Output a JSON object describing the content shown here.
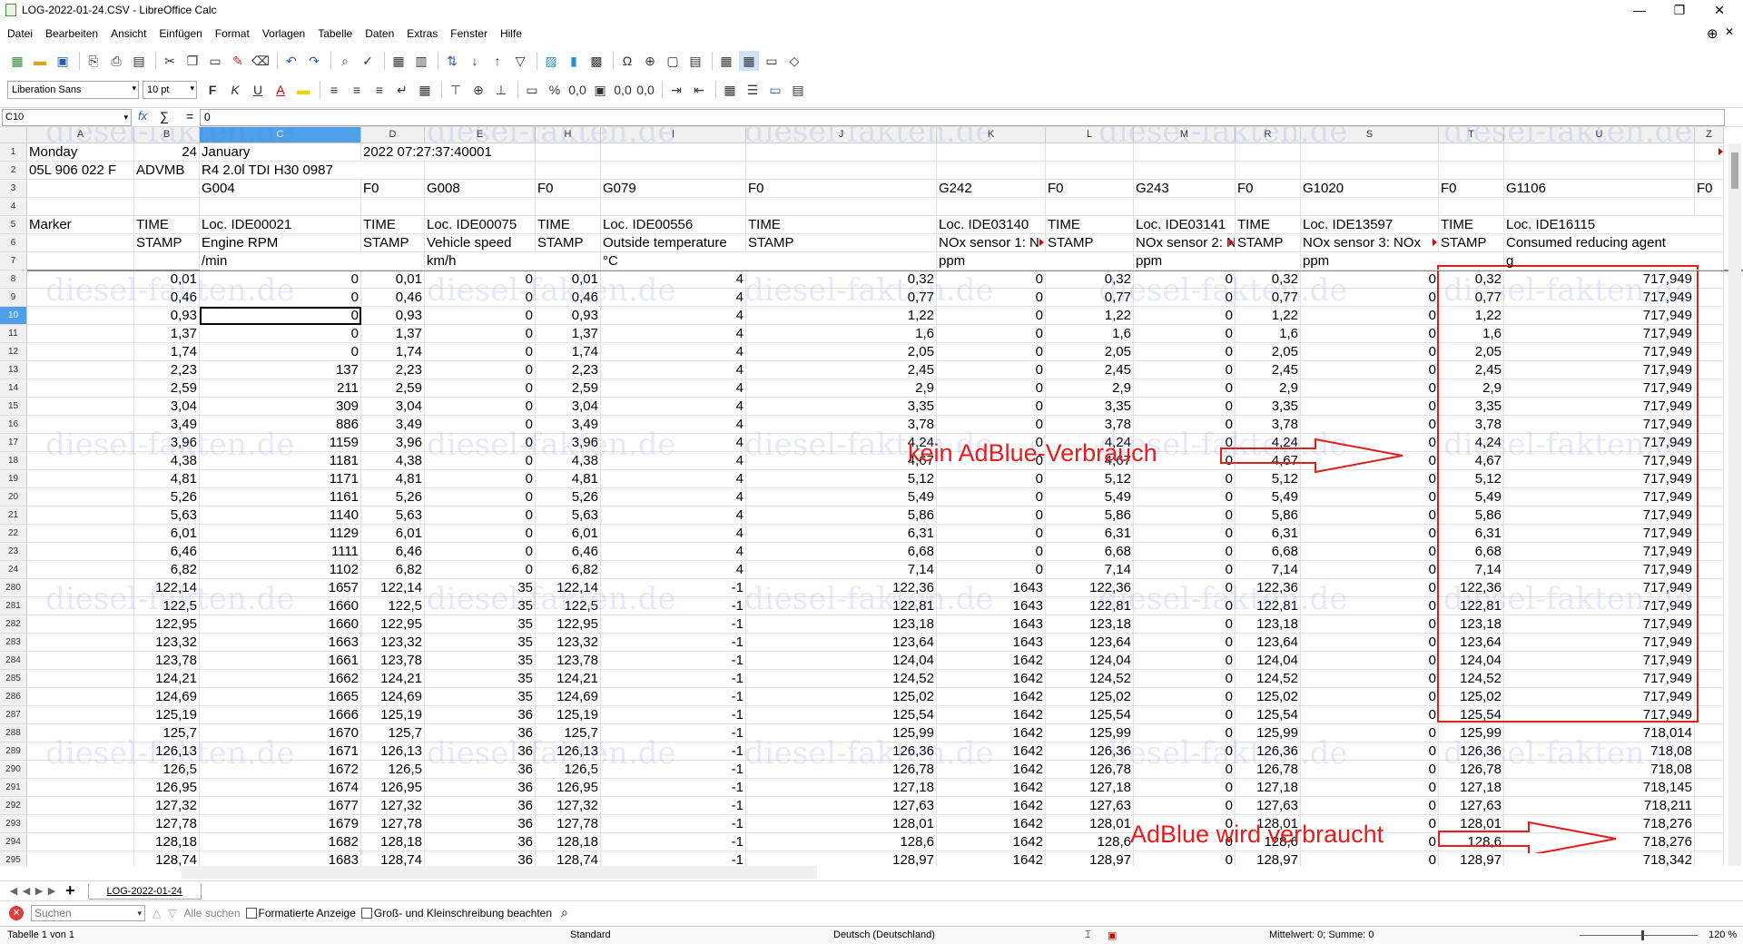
{
  "window": {
    "title": "LOG-2022-01-24.CSV - LibreOffice Calc",
    "minimize": "—",
    "maximize": "❐",
    "close": "✕"
  },
  "menu": [
    "Datei",
    "Bearbeiten",
    "Ansicht",
    "Einfügen",
    "Format",
    "Vorlagen",
    "Tabelle",
    "Daten",
    "Extras",
    "Fenster",
    "Hilfe"
  ],
  "toolbar2": {
    "font_name": "Liberation Sans",
    "font_size": "10 pt"
  },
  "formula_bar": {
    "cell_ref": "C10",
    "fx": "fx",
    "sigma": "∑",
    "equals": "=",
    "content": "0"
  },
  "columns": [
    "A",
    "B",
    "C",
    "D",
    "E",
    "H",
    "I",
    "J",
    "K",
    "L",
    "M",
    "R",
    "S",
    "T",
    "U",
    "Z"
  ],
  "header_rows": [
    {
      "row": "1",
      "cells": [
        "Monday",
        "24",
        "January",
        "2022 07:27:37:40001",
        "",
        "",
        "",
        "",
        "",
        "",
        "",
        "",
        "",
        "",
        "",
        ""
      ]
    },
    {
      "row": "2",
      "cells": [
        "05L 906 022 F",
        "ADVMB",
        "R4 2.0l TDI    H30 0987",
        "",
        "",
        "",
        "",
        "",
        "",
        "",
        "",
        "",
        "",
        "",
        "",
        ""
      ]
    },
    {
      "row": "3",
      "cells": [
        "",
        "",
        "G004",
        "F0",
        "G008",
        "F0",
        "G079",
        "F0",
        "G242",
        "F0",
        "G243",
        "F0",
        "G1020",
        "F0",
        "G1106",
        "F0"
      ]
    },
    {
      "row": "4",
      "cells": [
        "",
        "",
        "",
        "",
        "",
        "",
        "",
        "",
        "",
        "",
        "",
        "",
        "",
        "",
        "",
        ""
      ]
    },
    {
      "row": "5",
      "cells": [
        "Marker",
        "TIME",
        "Loc. IDE00021",
        "TIME",
        "Loc. IDE00075",
        "TIME",
        "Loc. IDE00556",
        "TIME",
        "Loc. IDE03140",
        "TIME",
        "Loc. IDE03141",
        "TIME",
        "Loc. IDE13597",
        "TIME",
        "Loc. IDE16115",
        ""
      ]
    },
    {
      "row": "6",
      "cells": [
        "",
        "STAMP",
        "Engine RPM",
        "STAMP",
        "Vehicle speed",
        "STAMP",
        "Outside temperature",
        "STAMP",
        "NOx sensor 1: N",
        "STAMP",
        "NOx sensor 2: N",
        "STAMP",
        "NOx sensor 3: NOx",
        "STAMP",
        "Consumed reducing agent",
        ""
      ]
    },
    {
      "row": "7",
      "cells": [
        "",
        "",
        "/min",
        "",
        "km/h",
        "",
        "°C",
        "",
        "ppm",
        "",
        "ppm",
        "",
        "ppm",
        "",
        "g",
        ""
      ]
    }
  ],
  "data_rows": [
    {
      "row": "8",
      "cells": [
        "",
        "0,01",
        "0",
        "0,01",
        "0",
        "0,01",
        "4",
        "0,32",
        "0",
        "0,32",
        "0",
        "0,32",
        "0",
        "0,32",
        "717,949",
        ""
      ]
    },
    {
      "row": "9",
      "cells": [
        "",
        "0,46",
        "0",
        "0,46",
        "0",
        "0,46",
        "4",
        "0,77",
        "0",
        "0,77",
        "0",
        "0,77",
        "0",
        "0,77",
        "717,949",
        ""
      ]
    },
    {
      "row": "10",
      "cells": [
        "",
        "0,93",
        "0",
        "0,93",
        "0",
        "0,93",
        "4",
        "1,22",
        "0",
        "1,22",
        "0",
        "1,22",
        "0",
        "1,22",
        "717,949",
        ""
      ]
    },
    {
      "row": "11",
      "cells": [
        "",
        "1,37",
        "0",
        "1,37",
        "0",
        "1,37",
        "4",
        "1,6",
        "0",
        "1,6",
        "0",
        "1,6",
        "0",
        "1,6",
        "717,949",
        ""
      ]
    },
    {
      "row": "12",
      "cells": [
        "",
        "1,74",
        "0",
        "1,74",
        "0",
        "1,74",
        "4",
        "2,05",
        "0",
        "2,05",
        "0",
        "2,05",
        "0",
        "2,05",
        "717,949",
        ""
      ]
    },
    {
      "row": "13",
      "cells": [
        "",
        "2,23",
        "137",
        "2,23",
        "0",
        "2,23",
        "4",
        "2,45",
        "0",
        "2,45",
        "0",
        "2,45",
        "0",
        "2,45",
        "717,949",
        ""
      ]
    },
    {
      "row": "14",
      "cells": [
        "",
        "2,59",
        "211",
        "2,59",
        "0",
        "2,59",
        "4",
        "2,9",
        "0",
        "2,9",
        "0",
        "2,9",
        "0",
        "2,9",
        "717,949",
        ""
      ]
    },
    {
      "row": "15",
      "cells": [
        "",
        "3,04",
        "309",
        "3,04",
        "0",
        "3,04",
        "4",
        "3,35",
        "0",
        "3,35",
        "0",
        "3,35",
        "0",
        "3,35",
        "717,949",
        ""
      ]
    },
    {
      "row": "16",
      "cells": [
        "",
        "3,49",
        "886",
        "3,49",
        "0",
        "3,49",
        "4",
        "3,78",
        "0",
        "3,78",
        "0",
        "3,78",
        "0",
        "3,78",
        "717,949",
        ""
      ]
    },
    {
      "row": "17",
      "cells": [
        "",
        "3,96",
        "1159",
        "3,96",
        "0",
        "3,96",
        "4",
        "4,24",
        "0",
        "4,24",
        "0",
        "4,24",
        "0",
        "4,24",
        "717,949",
        ""
      ]
    },
    {
      "row": "18",
      "cells": [
        "",
        "4,38",
        "1181",
        "4,38",
        "0",
        "4,38",
        "4",
        "4,67",
        "0",
        "4,67",
        "0",
        "4,67",
        "0",
        "4,67",
        "717,949",
        ""
      ]
    },
    {
      "row": "19",
      "cells": [
        "",
        "4,81",
        "1171",
        "4,81",
        "0",
        "4,81",
        "4",
        "5,12",
        "0",
        "5,12",
        "0",
        "5,12",
        "0",
        "5,12",
        "717,949",
        ""
      ]
    },
    {
      "row": "20",
      "cells": [
        "",
        "5,26",
        "1161",
        "5,26",
        "0",
        "5,26",
        "4",
        "5,49",
        "0",
        "5,49",
        "0",
        "5,49",
        "0",
        "5,49",
        "717,949",
        ""
      ]
    },
    {
      "row": "21",
      "cells": [
        "",
        "5,63",
        "1140",
        "5,63",
        "0",
        "5,63",
        "4",
        "5,86",
        "0",
        "5,86",
        "0",
        "5,86",
        "0",
        "5,86",
        "717,949",
        ""
      ]
    },
    {
      "row": "22",
      "cells": [
        "",
        "6,01",
        "1129",
        "6,01",
        "0",
        "6,01",
        "4",
        "6,31",
        "0",
        "6,31",
        "0",
        "6,31",
        "0",
        "6,31",
        "717,949",
        ""
      ]
    },
    {
      "row": "23",
      "cells": [
        "",
        "6,46",
        "1111",
        "6,46",
        "0",
        "6,46",
        "4",
        "6,68",
        "0",
        "6,68",
        "0",
        "6,68",
        "0",
        "6,68",
        "717,949",
        ""
      ]
    },
    {
      "row": "24",
      "cells": [
        "",
        "6,82",
        "1102",
        "6,82",
        "0",
        "6,82",
        "4",
        "7,14",
        "0",
        "7,14",
        "0",
        "7,14",
        "0",
        "7,14",
        "717,949",
        ""
      ]
    },
    {
      "row": "280",
      "cells": [
        "",
        "122,14",
        "1657",
        "122,14",
        "35",
        "122,14",
        "-1",
        "122,36",
        "1643",
        "122,36",
        "0",
        "122,36",
        "0",
        "122,36",
        "717,949",
        ""
      ]
    },
    {
      "row": "281",
      "cells": [
        "",
        "122,5",
        "1660",
        "122,5",
        "35",
        "122,5",
        "-1",
        "122,81",
        "1643",
        "122,81",
        "0",
        "122,81",
        "0",
        "122,81",
        "717,949",
        ""
      ]
    },
    {
      "row": "282",
      "cells": [
        "",
        "122,95",
        "1660",
        "122,95",
        "35",
        "122,95",
        "-1",
        "123,18",
        "1643",
        "123,18",
        "0",
        "123,18",
        "0",
        "123,18",
        "717,949",
        ""
      ]
    },
    {
      "row": "283",
      "cells": [
        "",
        "123,32",
        "1663",
        "123,32",
        "35",
        "123,32",
        "-1",
        "123,64",
        "1643",
        "123,64",
        "0",
        "123,64",
        "0",
        "123,64",
        "717,949",
        ""
      ]
    },
    {
      "row": "284",
      "cells": [
        "",
        "123,78",
        "1661",
        "123,78",
        "35",
        "123,78",
        "-1",
        "124,04",
        "1642",
        "124,04",
        "0",
        "124,04",
        "0",
        "124,04",
        "717,949",
        ""
      ]
    },
    {
      "row": "285",
      "cells": [
        "",
        "124,21",
        "1662",
        "124,21",
        "35",
        "124,21",
        "-1",
        "124,52",
        "1642",
        "124,52",
        "0",
        "124,52",
        "0",
        "124,52",
        "717,949",
        ""
      ]
    },
    {
      "row": "286",
      "cells": [
        "",
        "124,69",
        "1665",
        "124,69",
        "35",
        "124,69",
        "-1",
        "125,02",
        "1642",
        "125,02",
        "0",
        "125,02",
        "0",
        "125,02",
        "717,949",
        ""
      ]
    },
    {
      "row": "287",
      "cells": [
        "",
        "125,19",
        "1666",
        "125,19",
        "36",
        "125,19",
        "-1",
        "125,54",
        "1642",
        "125,54",
        "0",
        "125,54",
        "0",
        "125,54",
        "717,949",
        ""
      ]
    },
    {
      "row": "288",
      "cells": [
        "",
        "125,7",
        "1670",
        "125,7",
        "36",
        "125,7",
        "-1",
        "125,99",
        "1642",
        "125,99",
        "0",
        "125,99",
        "0",
        "125,99",
        "718,014",
        ""
      ]
    },
    {
      "row": "289",
      "cells": [
        "",
        "126,13",
        "1671",
        "126,13",
        "36",
        "126,13",
        "-1",
        "126,36",
        "1642",
        "126,36",
        "0",
        "126,36",
        "0",
        "126,36",
        "718,08",
        ""
      ]
    },
    {
      "row": "290",
      "cells": [
        "",
        "126,5",
        "1672",
        "126,5",
        "36",
        "126,5",
        "-1",
        "126,78",
        "1642",
        "126,78",
        "0",
        "126,78",
        "0",
        "126,78",
        "718,08",
        ""
      ]
    },
    {
      "row": "291",
      "cells": [
        "",
        "126,95",
        "1674",
        "126,95",
        "36",
        "126,95",
        "-1",
        "127,18",
        "1642",
        "127,18",
        "0",
        "127,18",
        "0",
        "127,18",
        "718,145",
        ""
      ]
    },
    {
      "row": "292",
      "cells": [
        "",
        "127,32",
        "1677",
        "127,32",
        "36",
        "127,32",
        "-1",
        "127,63",
        "1642",
        "127,63",
        "0",
        "127,63",
        "0",
        "127,63",
        "718,211",
        ""
      ]
    },
    {
      "row": "293",
      "cells": [
        "",
        "127,78",
        "1679",
        "127,78",
        "36",
        "127,78",
        "-1",
        "128,01",
        "1642",
        "128,01",
        "0",
        "128,01",
        "0",
        "128,01",
        "718,276",
        ""
      ]
    },
    {
      "row": "294",
      "cells": [
        "",
        "128,18",
        "1682",
        "128,18",
        "36",
        "128,18",
        "-1",
        "128,6",
        "1642",
        "128,6",
        "0",
        "128,6",
        "0",
        "128,6",
        "718,276",
        ""
      ]
    },
    {
      "row": "295",
      "cells": [
        "",
        "128,74",
        "1683",
        "128,74",
        "36",
        "128,74",
        "-1",
        "128,97",
        "1642",
        "128,97",
        "0",
        "128,97",
        "0",
        "128,97",
        "718,342",
        ""
      ]
    }
  ],
  "annotations": {
    "no_consumption": "kein AdBlue-Verbrauch",
    "consumption": "AdBlue wird verbraucht",
    "color": "#e02020"
  },
  "watermark": "diesel-fakten.de",
  "sheet_tab": "LOG-2022-01-24",
  "find_bar": {
    "placeholder": "Suchen",
    "find_all": "Alle suchen",
    "formatted_display": "Formatierte Anzeige",
    "match_case": "Groß- und Kleinschreibung beachten"
  },
  "status_bar": {
    "sheet": "Tabelle 1 von 1",
    "style": "Standard",
    "language": "Deutsch (Deutschland)",
    "summary": "Mittelwert: 0; Summe: 0",
    "zoom": "120 %"
  },
  "colors": {
    "selection_header": "#4ea1e6",
    "annotation_red": "#e02020"
  }
}
